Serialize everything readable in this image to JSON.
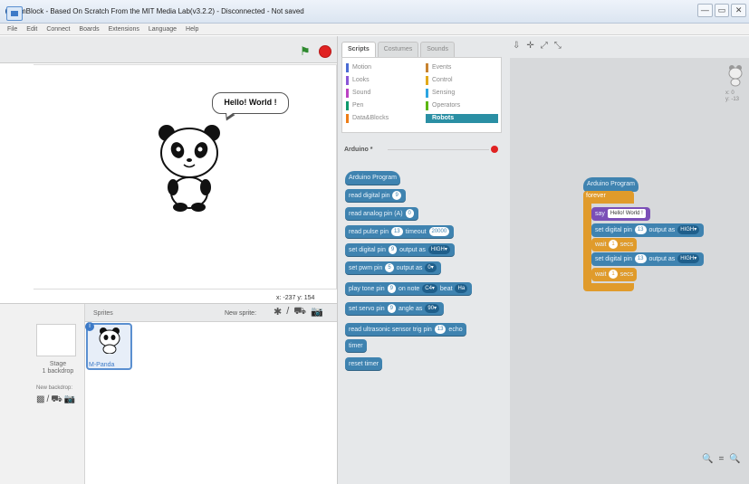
{
  "window": {
    "title": "mBlock - Based On Scratch From the MIT Media Lab(v3.2.2) - Disconnected - Not saved",
    "controls": [
      "—",
      "▭",
      "✕"
    ]
  },
  "menu": [
    "File",
    "Edit",
    "Connect",
    "Boards",
    "Extensions",
    "Language",
    "Help"
  ],
  "stage": {
    "speech": "Hello! World !",
    "coords": "x: -237  y: 154"
  },
  "sprites_pane": {
    "header": "Sprites",
    "new_sprite": "New sprite:",
    "stage_label": "Stage",
    "backdrops": "1 backdrop",
    "new_backdrop": "New backdrop:",
    "sprite_name": "M-Panda",
    "info_badge": "i"
  },
  "tabs": [
    "Scripts",
    "Costumes",
    "Sounds"
  ],
  "categories": [
    {
      "label": "Motion",
      "color": "#4a6cd4"
    },
    {
      "label": "Looks",
      "color": "#8a55d7"
    },
    {
      "label": "Sound",
      "color": "#bb42c3"
    },
    {
      "label": "Pen",
      "color": "#0e9a6c"
    },
    {
      "label": "Data&Blocks",
      "color": "#ee7d16"
    },
    {
      "label": "Events",
      "color": "#c88330"
    },
    {
      "label": "Control",
      "color": "#e1a91a"
    },
    {
      "label": "Sensing",
      "color": "#2ca5e2"
    },
    {
      "label": "Operators",
      "color": "#5cb712"
    },
    {
      "label": "Robots",
      "color": "#2a8fa4"
    }
  ],
  "arduino_header": "Arduino *",
  "palette_blocks": [
    {
      "text": "Arduino Program",
      "parts": []
    },
    {
      "text": "read digital pin",
      "parts": [
        "9"
      ]
    },
    {
      "text": "read analog pin (A)",
      "parts": [
        "0"
      ]
    },
    {
      "text": "read pulse pin",
      "parts": [
        "13",
        "timeout",
        "20000"
      ]
    },
    {
      "text": "set digital pin",
      "parts": [
        "9",
        "output as",
        "HIGH▾"
      ]
    },
    {
      "text": "set pwm pin",
      "parts": [
        "5",
        "output as",
        "0▾"
      ]
    },
    {
      "text": "play tone pin",
      "parts": [
        "9",
        "on note",
        "C4▾",
        "beat",
        "Ha"
      ]
    },
    {
      "text": "set servo pin",
      "parts": [
        "9",
        "angle as",
        "90▾"
      ]
    },
    {
      "text": "read ultrasonic sensor trig pin",
      "parts": [
        "13",
        "echo"
      ]
    },
    {
      "text": "timer",
      "parts": []
    },
    {
      "text": "reset timer",
      "parts": []
    }
  ],
  "script": {
    "hat": "Arduino Program",
    "forever": "forever",
    "say_label": "say",
    "say_value": "Hello! World !",
    "set1": {
      "label": "set digital pin",
      "pin": "13",
      "mid": "output as",
      "value": "HIGH▾"
    },
    "wait1": {
      "label": "wait",
      "value": "1",
      "unit": "secs"
    },
    "set2": {
      "label": "set digital pin",
      "pin": "13",
      "mid": "output as",
      "value": "HIGH▾"
    },
    "wait2": {
      "label": "wait",
      "value": "1",
      "unit": "secs"
    }
  },
  "corner_xy": [
    "x: 0",
    "y: -13"
  ],
  "zoom": [
    "🔍",
    "=",
    "🔍"
  ],
  "icons": {
    "flag": "⚑",
    "tools": [
      "⇩",
      "✛",
      "⤢",
      "⤡"
    ],
    "new_sprite": [
      "✱",
      "/",
      "⛟",
      "📷"
    ],
    "new_backdrop": [
      "▩",
      "/",
      "⛟",
      "📷"
    ]
  }
}
